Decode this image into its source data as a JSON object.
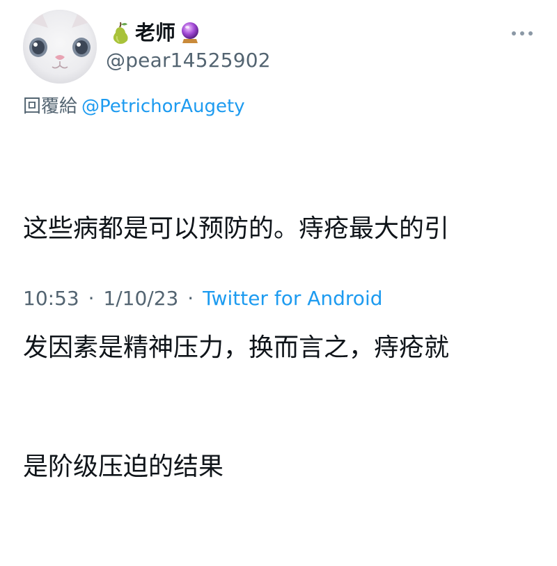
{
  "author": {
    "display_name": "老师",
    "handle": "@pear14525902",
    "badge_left": "pear-emoji-icon",
    "badge_right": "crystal-ball-emoji-icon"
  },
  "reply": {
    "prefix": "回覆給",
    "target": "@PetrichorAugety"
  },
  "tweet": {
    "text_lines": [
      "这些病都是可以预防的。痔疮最大的引",
      "发因素是精神压力，换而言之，痔疮就",
      "是阶级压迫的结果"
    ]
  },
  "meta": {
    "time": "10:53",
    "date": "1/10/23",
    "separator": "·",
    "source": "Twitter for Android"
  },
  "colors": {
    "text": "#0f1419",
    "secondary": "#536471",
    "link": "#1d9bf0"
  }
}
